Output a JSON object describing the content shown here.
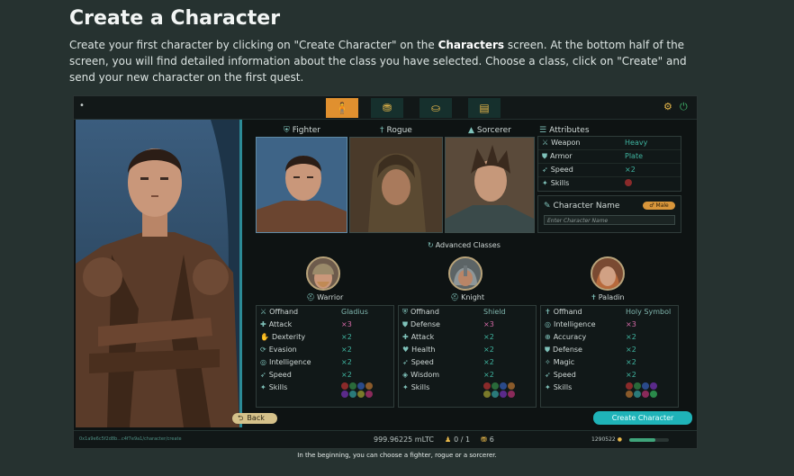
{
  "article": {
    "title": "Create a Character",
    "intro_1": "Create your first character by clicking on \"Create Character\" on the ",
    "intro_bold": "Characters",
    "intro_2": " screen. At the bottom half of the screen, you will find detailed information about the class you have selected. Choose a class, click on \"Create\" and send your new character on the first quest.",
    "caption": "In the beginning, you can choose a fighter, rogue or a sorcerer."
  },
  "game": {
    "menu_icon": "•",
    "tabs": [
      {
        "icon": "character-icon",
        "glyph": "🧍"
      },
      {
        "icon": "chest-icon",
        "glyph": "⛃"
      },
      {
        "icon": "bag-icon",
        "glyph": "⛀"
      },
      {
        "icon": "scroll-icon",
        "glyph": "▤"
      }
    ],
    "settings_icon": "⚙",
    "power_icon": "⏻",
    "base_classes": [
      {
        "name": "Fighter",
        "icon": "shield-icon"
      },
      {
        "name": "Rogue",
        "icon": "dagger-icon"
      },
      {
        "name": "Sorcerer",
        "icon": "hat-icon"
      }
    ],
    "attributes": {
      "title": "Attributes",
      "rows": [
        {
          "label": "Weapon",
          "value": "Heavy"
        },
        {
          "label": "Armor",
          "value": "Plate"
        },
        {
          "label": "Speed",
          "value": "×2"
        },
        {
          "label": "Skills",
          "value": ""
        }
      ]
    },
    "character_name": {
      "label": "Character Name",
      "gender": "Male",
      "placeholder": "Enter Character Name"
    },
    "advanced_title": "Advanced Classes",
    "advanced_classes": [
      {
        "name": "Warrior",
        "rows": [
          {
            "label": "Offhand",
            "value": "Gladius"
          },
          {
            "label": "Attack",
            "value": "×3"
          },
          {
            "label": "Dexterity",
            "value": "×2"
          },
          {
            "label": "Evasion",
            "value": "×2"
          },
          {
            "label": "Intelligence",
            "value": "×2"
          },
          {
            "label": "Speed",
            "value": "×2"
          },
          {
            "label": "Skills",
            "value": ""
          }
        ]
      },
      {
        "name": "Knight",
        "rows": [
          {
            "label": "Offhand",
            "value": "Shield"
          },
          {
            "label": "Defense",
            "value": "×3"
          },
          {
            "label": "Attack",
            "value": "×2"
          },
          {
            "label": "Health",
            "value": "×2"
          },
          {
            "label": "Speed",
            "value": "×2"
          },
          {
            "label": "Wisdom",
            "value": "×2"
          },
          {
            "label": "Skills",
            "value": ""
          }
        ]
      },
      {
        "name": "Paladin",
        "rows": [
          {
            "label": "Offhand",
            "value": "Holy Symbol"
          },
          {
            "label": "Intelligence",
            "value": "×3"
          },
          {
            "label": "Accuracy",
            "value": "×2"
          },
          {
            "label": "Defense",
            "value": "×2"
          },
          {
            "label": "Magic",
            "value": "×2"
          },
          {
            "label": "Speed",
            "value": "×2"
          },
          {
            "label": "Skills",
            "value": ""
          }
        ]
      }
    ],
    "back_label": "Back",
    "create_label": "Create Character",
    "status": {
      "link": "0x1a9e6c5f2d8b...c4f7e9a1/character/create",
      "balance": "999.96225 mLTC",
      "characters": "0 / 1",
      "items": "6",
      "xp": "1290522",
      "xp_progress": 0.65
    },
    "colors": {
      "accent": "#e0902f",
      "teal": "#1fb3b8",
      "multiplier_high": "#d66aa8"
    }
  }
}
